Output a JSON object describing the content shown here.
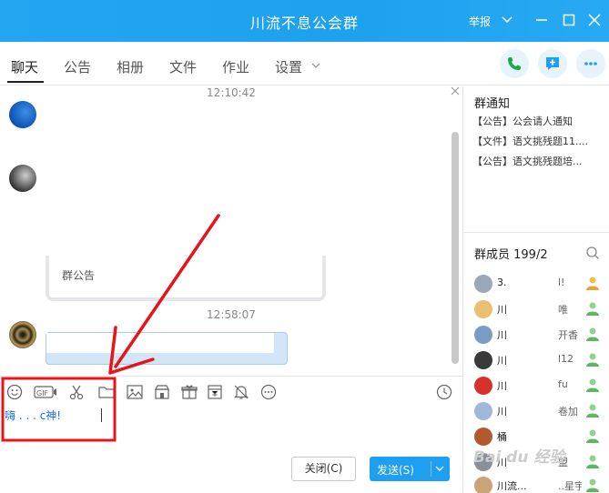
{
  "window": {
    "title": "川流不息公会群",
    "report_label": "举报"
  },
  "tabs": [
    {
      "label": "聊天"
    },
    {
      "label": "公告"
    },
    {
      "label": "相册"
    },
    {
      "label": "文件"
    },
    {
      "label": "作业"
    },
    {
      "label": "设置"
    }
  ],
  "chat": {
    "timestamp_1": "12:10:42",
    "timestamp_2": "12:58:07",
    "card_label": "群公告"
  },
  "input": {
    "text": "嗨  .   .   .   c神!"
  },
  "buttons": {
    "close_label": "关闭(C)",
    "send_label": "发送(S)"
  },
  "right_panel": {
    "notice_title": "群通知",
    "notices": [
      "【公告】公会请人通知",
      "【文件】语文挑残题11....",
      "【公告】语文挑残题培..."
    ],
    "members_title": "群成员 199/2",
    "members": [
      {
        "name": "3.",
        "extra": "l!"
      },
      {
        "name": "川",
        "extra": "唯"
      },
      {
        "name": "川",
        "extra": "开香"
      },
      {
        "name": "川",
        "extra": "l12"
      },
      {
        "name": "川",
        "extra": "fu"
      },
      {
        "name": "川",
        "extra": "卷加"
      },
      {
        "name": "桶",
        "extra": ""
      },
      {
        "name": "川",
        "extra": "盟"
      },
      {
        "name": "川流...",
        "extra": "..星宇"
      }
    ]
  },
  "watermark": "Bai du 经验",
  "colors": {
    "titlebar": "#1ea2ee",
    "send_button": "#1e9ff2",
    "annotation_red": "#e8141a",
    "member_person_icon": "#e9a23b"
  },
  "icons": [
    "emoji-icon",
    "gif-icon",
    "scissors-icon",
    "folder-icon",
    "image-icon",
    "shop-icon",
    "gift-icon",
    "calendar-icon",
    "bell-icon",
    "more-icon",
    "clock-icon",
    "phone-icon",
    "add-chat-icon",
    "menu-dots-icon"
  ]
}
